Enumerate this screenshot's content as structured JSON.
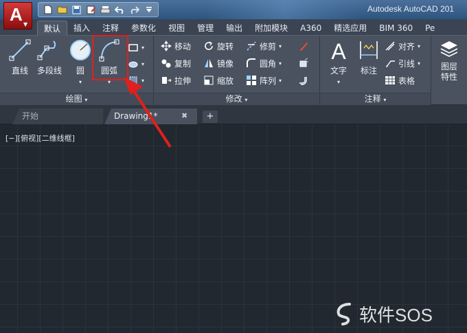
{
  "titlebar": {
    "app_letter": "A",
    "title": "Autodesk AutoCAD 201",
    "qat_icons": [
      "new-icon",
      "open-icon",
      "save-icon",
      "saveas-icon",
      "print-icon",
      "undo-icon",
      "redo-icon",
      "customize-icon"
    ]
  },
  "ribbon_tabs": [
    "默认",
    "插入",
    "注释",
    "参数化",
    "视图",
    "管理",
    "输出",
    "附加模块",
    "A360",
    "精选应用",
    "BIM 360",
    "Pe"
  ],
  "active_tab": "默认",
  "panels": {
    "draw": {
      "title": "绘图",
      "line": "直线",
      "polyline": "多段线",
      "circle": "圆",
      "arc": "圆弧"
    },
    "modify": {
      "title": "修改",
      "move": "移动",
      "rotate": "旋转",
      "trim": "修剪",
      "copy": "复制",
      "mirror": "镜像",
      "fillet": "圆角",
      "stretch": "拉伸",
      "scale": "缩放",
      "array": "阵列"
    },
    "annotation": {
      "title": "注释",
      "text": "文字",
      "dimension": "标注",
      "align": "对齐",
      "leader": "引线",
      "table": "表格"
    },
    "layers": {
      "properties": "图层\n特性"
    }
  },
  "doc_tabs": {
    "start": "开始",
    "drawing": "Drawing1*",
    "add": "+"
  },
  "viewport_label": "[−][俯视][二维线框]",
  "watermark": "软件SOS",
  "colors": {
    "highlight": "#e0201d",
    "canvas": "#212830",
    "ribbon": "#4a5260"
  }
}
